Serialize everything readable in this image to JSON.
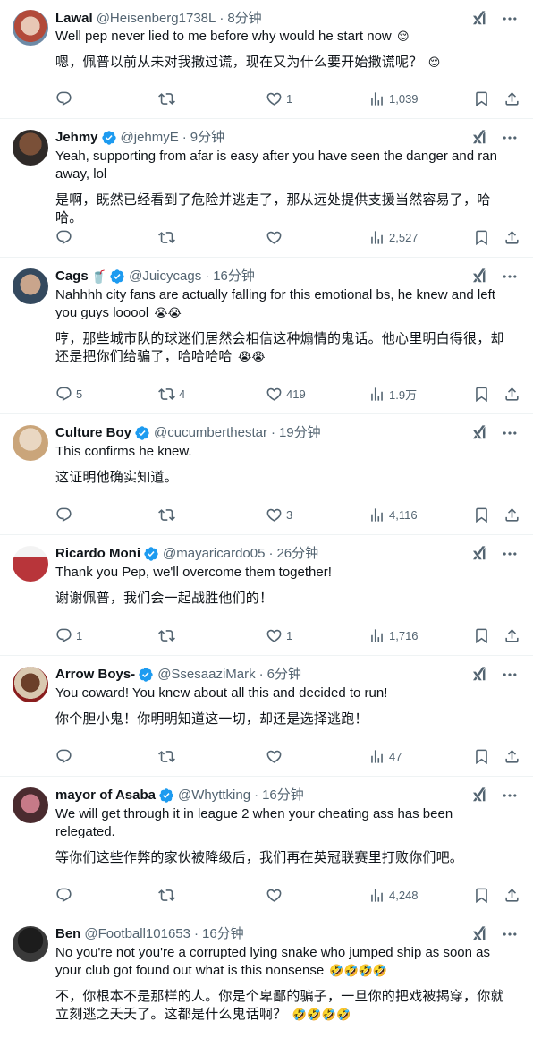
{
  "colors": {
    "verified": "#1d9bf0",
    "icon_gray": "#536471",
    "text": "#0f1419",
    "divider": "#eff3f4"
  },
  "tweets": [
    {
      "name": "Lawal",
      "verified": false,
      "name_emoji": "",
      "handle": "@Heisenberg1738L",
      "time": "8分钟",
      "text": "Well pep never lied to me before why would he start now",
      "text_emoji": "😌",
      "translation": "嗯，佩普以前从未对我撒过谎，现在又为什么要开始撒谎呢？",
      "translation_emoji": "😌",
      "replies": "",
      "retweets": "",
      "likes": "1",
      "views": "1,039"
    },
    {
      "name": "Jehmy",
      "verified": true,
      "name_emoji": "",
      "handle": "@jehmyE",
      "time": "9分钟",
      "text": "Yeah, supporting from afar is easy after you have seen the danger and ran away, lol",
      "text_emoji": "",
      "translation": "是啊，既然已经看到了危险并逃走了，那从远处提供支援当然容易了，哈哈。",
      "translation_emoji": "",
      "replies": "",
      "retweets": "",
      "likes": "",
      "views": "2,527"
    },
    {
      "name": "Cags",
      "verified": true,
      "name_emoji": "🥤",
      "handle": "@Juicycags",
      "time": "16分钟",
      "text": "Nahhhh city fans are actually falling for this emotional bs, he knew and left you guys looool",
      "text_emoji": "😭😭",
      "translation": "哼，那些城市队的球迷们居然会相信这种煽情的鬼话。他心里明白得很，却还是把你们给骗了，哈哈哈哈",
      "translation_emoji": "😭😭",
      "replies": "5",
      "retweets": "4",
      "likes": "419",
      "views": "1.9万"
    },
    {
      "name": "Culture Boy",
      "verified": true,
      "name_emoji": "",
      "handle": "@cucumberthestar",
      "time": "19分钟",
      "text": "This confirms he knew.",
      "text_emoji": "",
      "translation": "这证明他确实知道。",
      "translation_emoji": "",
      "replies": "",
      "retweets": "",
      "likes": "3",
      "views": "4,116"
    },
    {
      "name": "Ricardo Moni",
      "verified": true,
      "name_emoji": "",
      "handle": "@mayaricardo05",
      "time": "26分钟",
      "text": "Thank you Pep, we'll overcome them together!",
      "text_emoji": "",
      "translation": "谢谢佩普，我们会一起战胜他们的！",
      "translation_emoji": "",
      "replies": "1",
      "retweets": "",
      "likes": "1",
      "views": "1,716"
    },
    {
      "name": "Arrow Boys-",
      "verified": true,
      "name_emoji": "",
      "handle": "@SsesaaziMark",
      "time": "6分钟",
      "text": "You coward! You knew about all this and decided to run!",
      "text_emoji": "",
      "translation": "你个胆小鬼！你明明知道这一切，却还是选择逃跑！",
      "translation_emoji": "",
      "replies": "",
      "retweets": "",
      "likes": "",
      "views": "47"
    },
    {
      "name": "mayor of Asaba",
      "verified": true,
      "name_emoji": "",
      "handle": "@Whyttking",
      "time": "16分钟",
      "text": "We will get through it in league 2 when your cheating ass has been relegated.",
      "text_emoji": "",
      "translation": "等你们这些作弊的家伙被降级后，我们再在英冠联赛里打败你们吧。",
      "translation_emoji": "",
      "replies": "",
      "retweets": "",
      "likes": "",
      "views": "4,248"
    },
    {
      "name": "Ben",
      "verified": false,
      "name_emoji": "",
      "handle": "@Football101653",
      "time": "16分钟",
      "text": "No you're not you're a corrupted lying snake who jumped ship as soon as your club got found out what is this nonsense",
      "text_emoji": "🤣🤣🤣🤣",
      "translation": "不，你根本不是那样的人。你是个卑鄙的骗子，一旦你的把戏被揭穿，你就立刻逃之夭夭了。这都是什么鬼话啊？",
      "translation_emoji": "🤣🤣🤣🤣",
      "replies": "",
      "retweets": "",
      "likes": "",
      "views": ""
    }
  ]
}
